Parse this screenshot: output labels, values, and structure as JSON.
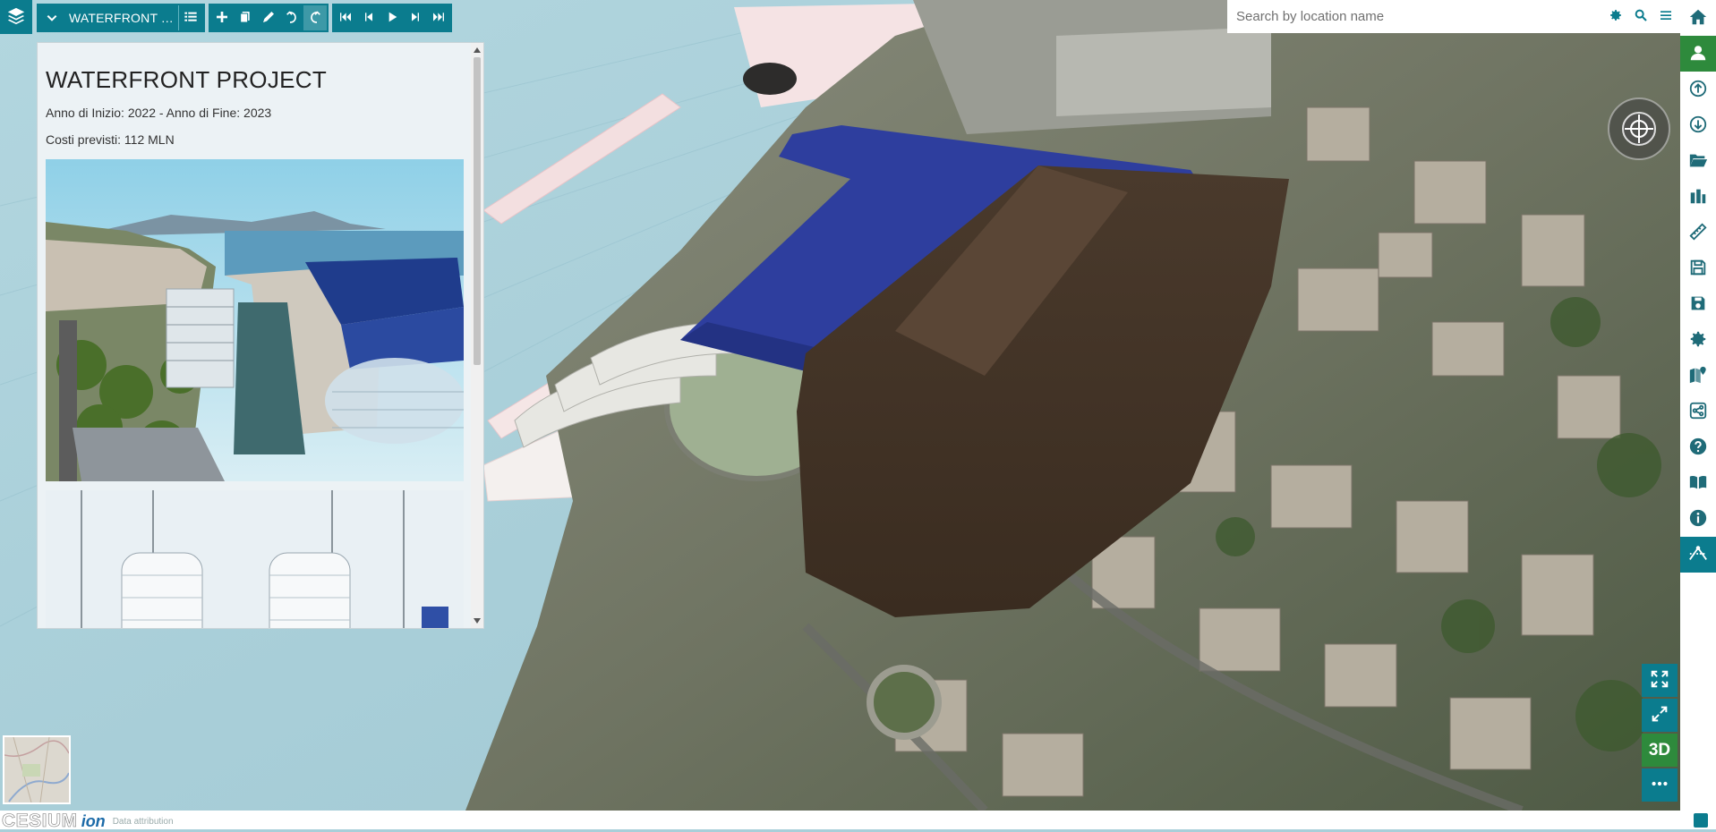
{
  "toolbar": {
    "title": "WATERFRONT T...",
    "groups": [
      "edit",
      "playback"
    ]
  },
  "panel": {
    "title": "WATERFRONT PROJECT",
    "years": "Anno di Inizio: 2022 - Anno di Fine: 2023",
    "costs": "Costi previsti: 112 MLN"
  },
  "search": {
    "placeholder": "Search by location name"
  },
  "sidebar": {
    "items": [
      "home-icon",
      "user-icon",
      "upload-icon",
      "download-icon",
      "folder-open-icon",
      "layers-stack-icon",
      "ruler-icon",
      "save-icon",
      "save-as-icon",
      "settings-icon",
      "map-marker-icon",
      "share-icon",
      "help-icon",
      "book-icon",
      "info-icon",
      "terrain-profile-icon"
    ]
  },
  "nav": {
    "mode_label": "3D"
  },
  "footer": {
    "logo": "CESIUM",
    "ion": "ion",
    "attribution": "Data attribution"
  },
  "colors": {
    "accent": "#0b7c8e",
    "green": "#2e8a3c",
    "panel_bg": "#ecf2f5"
  }
}
